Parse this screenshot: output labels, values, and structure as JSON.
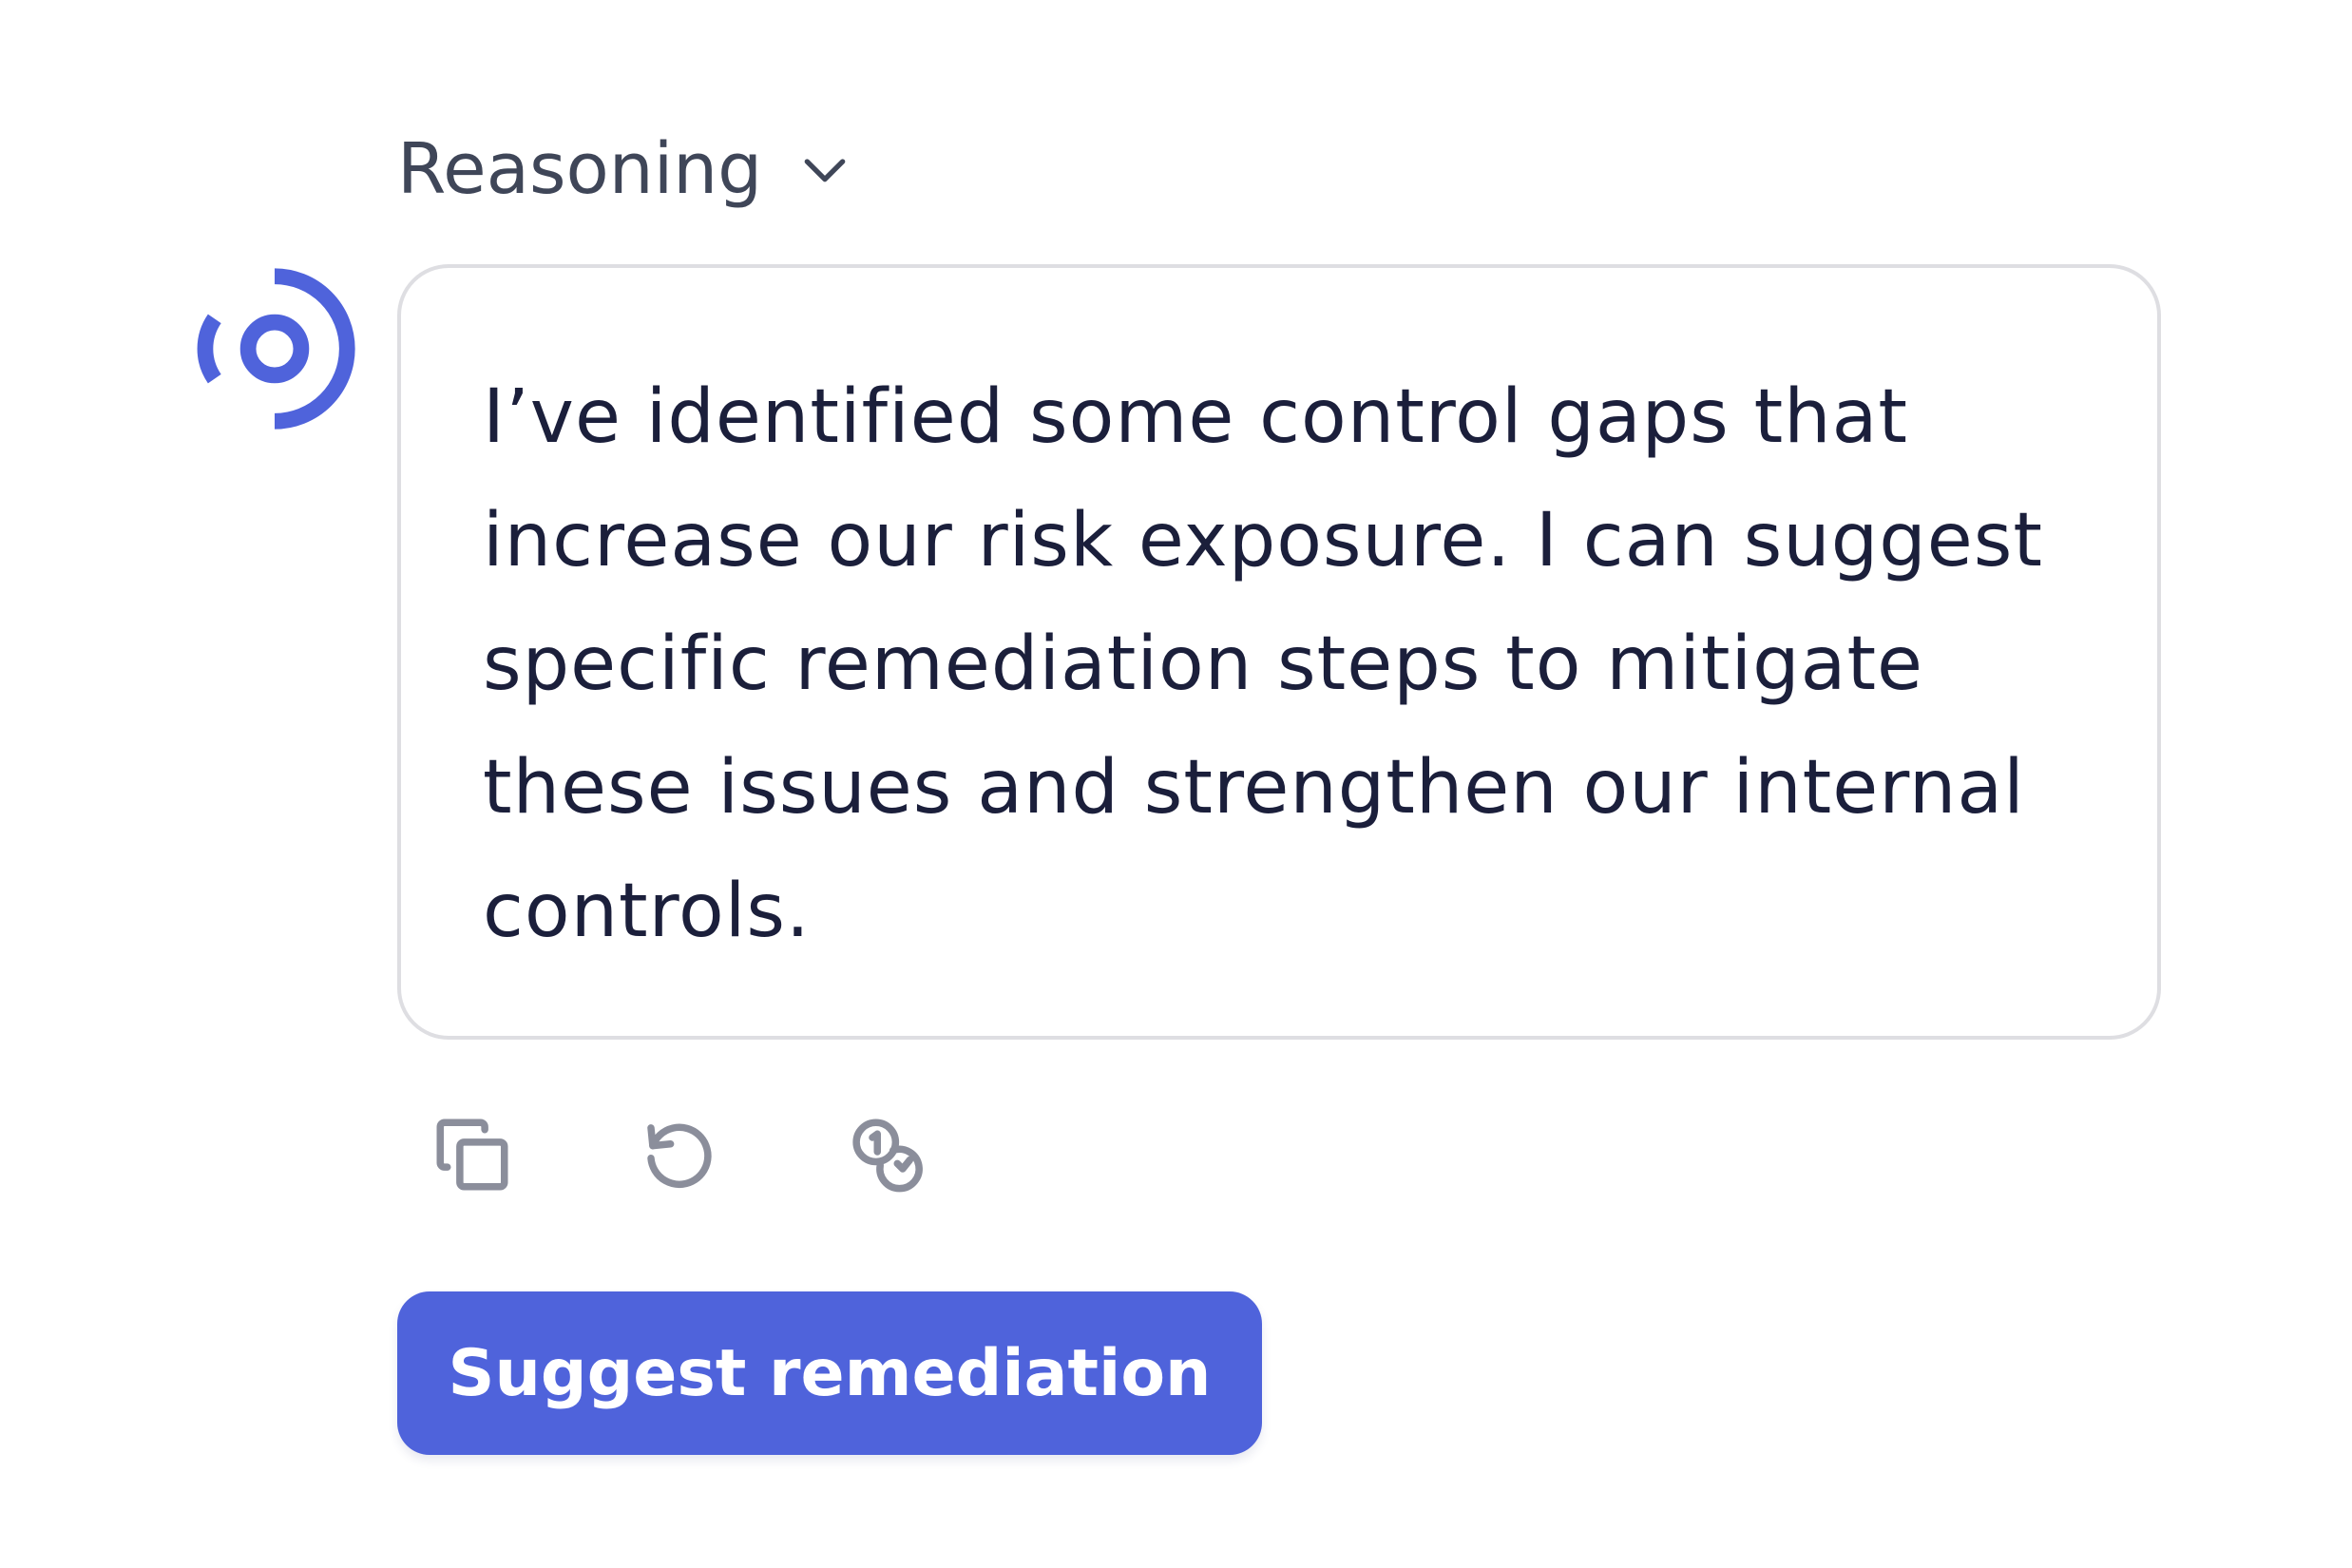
{
  "reasoning": {
    "label": "Reasoning",
    "icon": "chevron-down-icon"
  },
  "avatar": {
    "icon": "assistant-signal-icon",
    "color": "#4f63db"
  },
  "message": {
    "text": "I’ve identified some control gaps that increase our risk exposure. I can suggest specific remediation steps to mitigate these issues and strengthen our internal controls."
  },
  "actions": [
    {
      "icon": "copy-icon"
    },
    {
      "icon": "regenerate-icon"
    },
    {
      "icon": "tokens-icon"
    }
  ],
  "primary_action": {
    "label": "Suggest remediation",
    "color": "#4f63db"
  },
  "colors": {
    "accent": "#4f63db",
    "text": "#1b1f3b",
    "muted_text": "#3f4658",
    "icon_gray": "#8b8e9b",
    "border": "#dedee2"
  }
}
